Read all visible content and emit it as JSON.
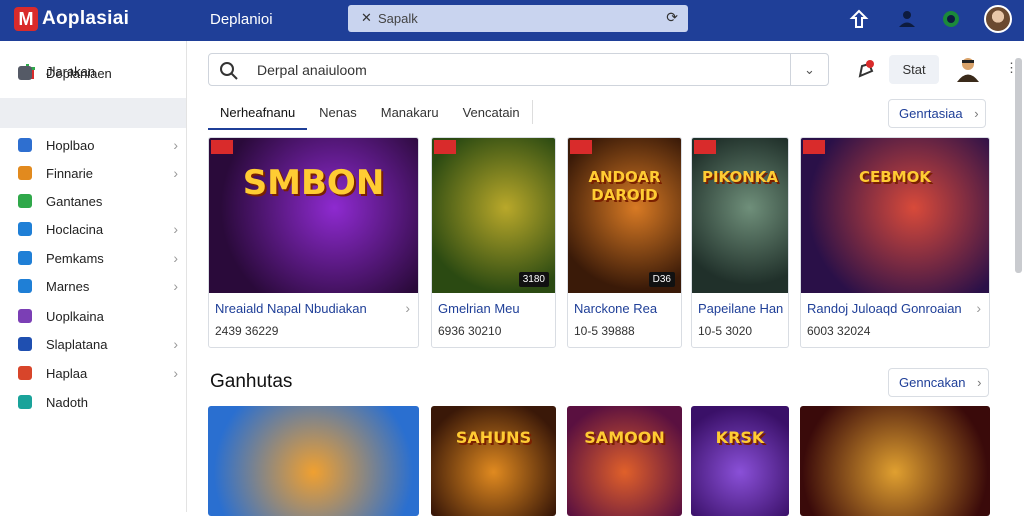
{
  "topbar": {
    "logo_letter": "M",
    "logo_text": "Aoplasiai",
    "title": "Deplanioi",
    "search_placeholder": "Sapalk"
  },
  "sidebar": {
    "header_label": "Jlarakan",
    "items": [
      {
        "label": "Deplaniaen",
        "color": "#555a66",
        "chevron": false,
        "active": true
      },
      {
        "label": "Hoplbao",
        "color": "#2e6fd0",
        "chevron": true
      },
      {
        "label": "Finnarie",
        "color": "#e28a1e",
        "chevron": true
      },
      {
        "label": "Gantanes",
        "color": "#2fa84a",
        "chevron": false
      },
      {
        "label": "Hoclacina",
        "color": "#1f7fd6",
        "chevron": true
      },
      {
        "label": "Pemkams",
        "color": "#1f7fd6",
        "chevron": true
      },
      {
        "label": "Marnes",
        "color": "#1f7fd6",
        "chevron": true
      },
      {
        "label": "Uoplkaina",
        "color": "#7b3fb5",
        "chevron": false
      },
      {
        "label": "Slaplatana",
        "color": "#1f4fb0",
        "chevron": true
      },
      {
        "label": "Haplaa",
        "color": "#d8452a",
        "chevron": true
      },
      {
        "label": "Nadoth",
        "color": "#1aa39a",
        "chevron": false
      }
    ]
  },
  "search": {
    "value": "Derpal anaiuloom"
  },
  "header": {
    "button_label": "Stat"
  },
  "tabs": [
    "Nerheafnanu",
    "Nenas",
    "Manakaru",
    "Vencatain"
  ],
  "see_all_1": "Genrtasiaa",
  "see_all_2": "Genncakan",
  "section_title": "Ganhutas",
  "cards": [
    {
      "title": "Nreaiald Napal Nbudiakan",
      "meta": "2439 36229",
      "art_text": "SMBON",
      "badge": "",
      "theme": [
        "#2a0a3a",
        "#8e2ad0"
      ]
    },
    {
      "title": "Gmelrian Meu",
      "meta": "6936 30210",
      "art_text": "",
      "badge": "3180",
      "theme": [
        "#2b4a12",
        "#b9a82a"
      ]
    },
    {
      "title": "Narckone Rea",
      "meta": "10-5 39888",
      "art_text": "ANDOAR DAROID",
      "badge": "D36",
      "theme": [
        "#3a1a08",
        "#d87a24"
      ]
    },
    {
      "title": "Papeilane Han",
      "meta": "10-5 3020",
      "art_text": "PIKONKA",
      "badge": "",
      "theme": [
        "#20302a",
        "#6f8f7a"
      ]
    },
    {
      "title": "Randoj Juloaqd Gonroaian",
      "meta": "6003 32024",
      "art_text": "CEBMOK",
      "badge": "",
      "theme": [
        "#2a1048",
        "#d84a3a"
      ]
    }
  ],
  "row2_titles": [
    "",
    "SAHUNS",
    "SAMOON",
    "KRSK",
    ""
  ]
}
